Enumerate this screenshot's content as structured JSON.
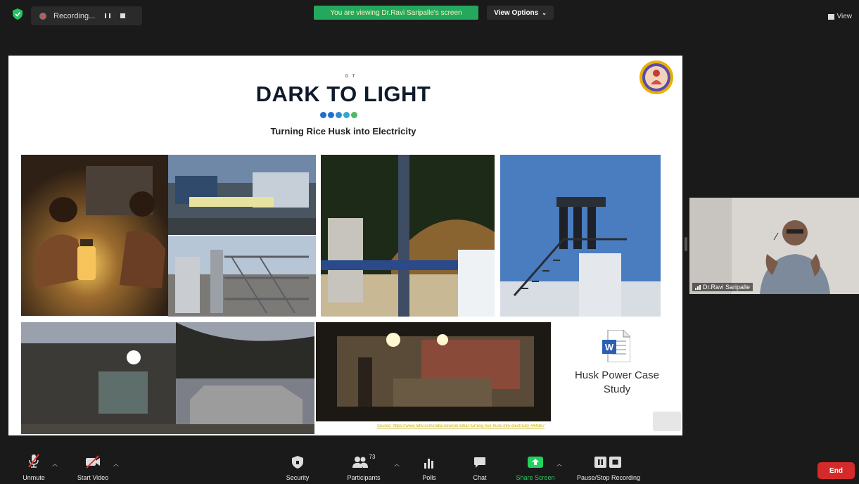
{
  "topbar": {
    "recording_label": "Recording...",
    "viewing_banner": "You are viewing Dr.Ravi Saripalle's screen",
    "view_options_label": "View Options",
    "view_label": "View"
  },
  "slide": {
    "dt_small": "D T",
    "title": "DARK TO LIGHT",
    "subtitle": "Turning Rice Husk into Electricity",
    "dot_colors": [
      "#1f6fd1",
      "#1f6fd1",
      "#2f8ad6",
      "#35a8c8",
      "#4fb86a"
    ],
    "case_study_label": "Husk Power Case Study",
    "source_text": "Source: https://www.ndtv.com/india-news/in-bihar-turning-rice-husk-into-electricity-444887",
    "doc_icon_letter": "W"
  },
  "participant": {
    "name": "Dr.Ravi Saripalle"
  },
  "toolbar": {
    "unmute_label": "Unmute",
    "start_video_label": "Start Video",
    "security_label": "Security",
    "participants_label": "Participants",
    "participants_count": "73",
    "polls_label": "Polls",
    "chat_label": "Chat",
    "share_screen_label": "Share Screen",
    "pause_stop_label": "Pause/Stop Recording",
    "end_label": "End"
  },
  "colors": {
    "accent_green": "#23d160",
    "banner_green": "#23a85d",
    "end_red": "#d42a2a",
    "source_yellow": "#c9b400"
  }
}
